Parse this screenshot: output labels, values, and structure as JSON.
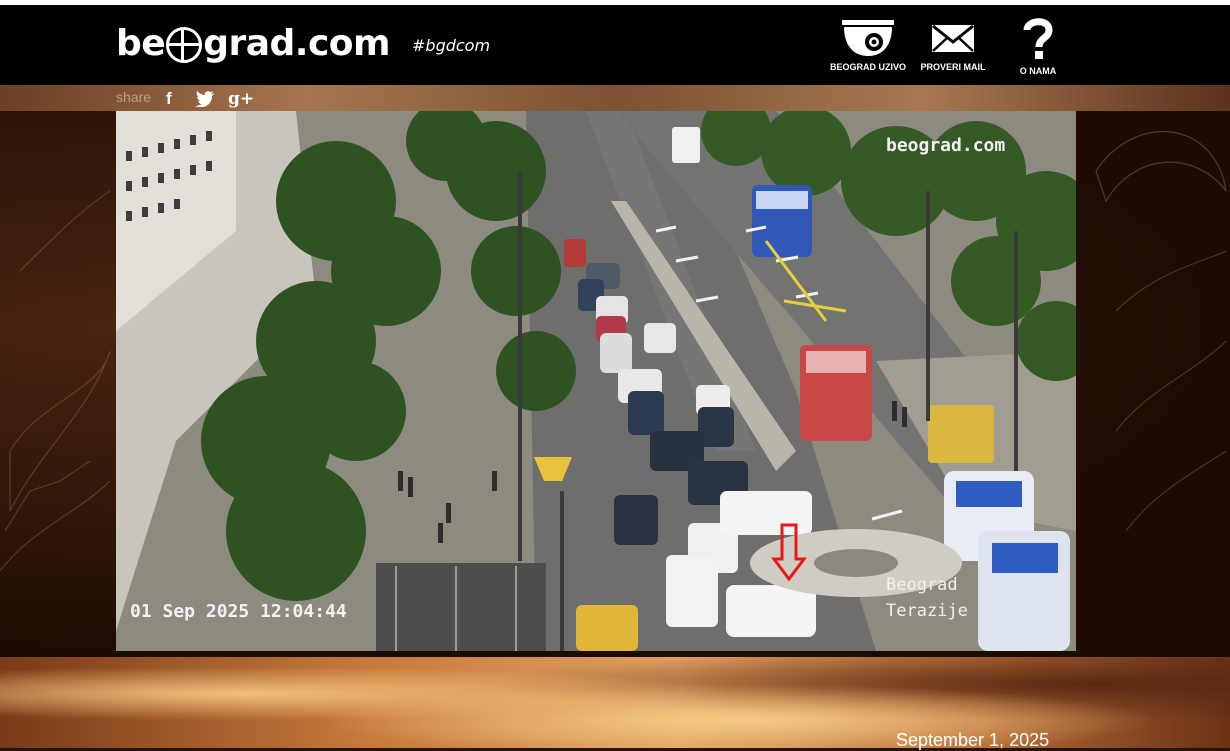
{
  "header": {
    "logo_text_1": "be",
    "logo_text_2": "grad.com",
    "hashtag": "#bgdcom",
    "nav": [
      {
        "label": "BEOGRAD UZIVO",
        "icon": "security-camera-icon"
      },
      {
        "label": "PROVERI MAIL",
        "icon": "envelope-icon"
      },
      {
        "label": "O NAMA",
        "icon": "question-mark-icon"
      }
    ]
  },
  "share": {
    "label": "share",
    "facebook": "f",
    "twitter": "twitter-bird-icon",
    "googleplus": "g+"
  },
  "camera": {
    "watermark": "beograd.com",
    "timestamp": "01 Sep 2025 12:04:44",
    "location_line1": "Beograd",
    "location_line2": "Terazije"
  },
  "footer": {
    "date": "September 1, 2025"
  }
}
